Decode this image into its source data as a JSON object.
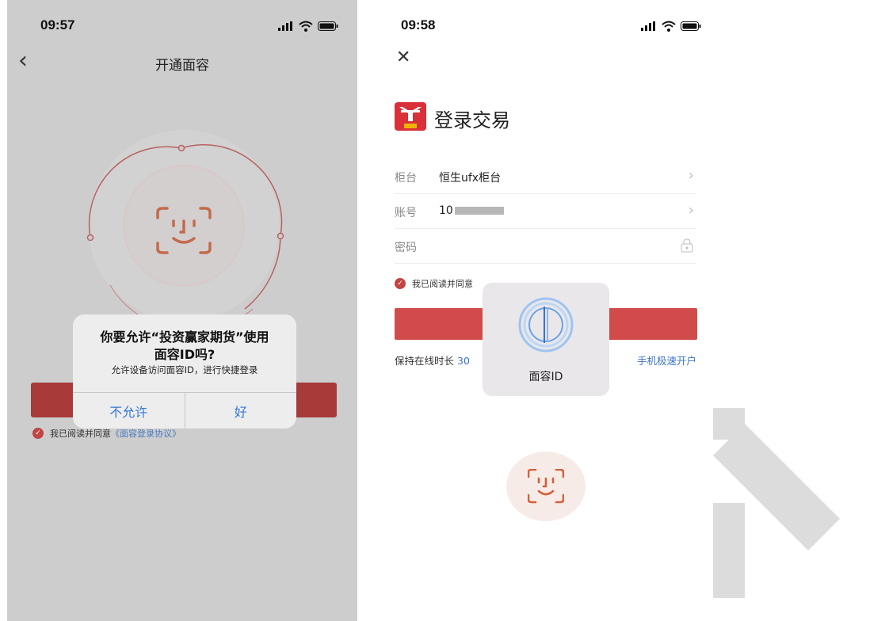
{
  "left_screen": {
    "time": "09:57",
    "nav_title": "开通面容",
    "dialog": {
      "title_line1": "你要允许“投资赢家期货”使用",
      "title_line2": "面容ID吗?",
      "message": "允许设备访问面容ID，进行快捷登录",
      "deny_label": "不允许",
      "allow_label": "好"
    },
    "agree_text": "我已阅读并同意",
    "agree_link": "《面容登录协议》"
  },
  "right_screen": {
    "time": "09:58",
    "title": "登录交易",
    "form": {
      "counter_label": "柜台",
      "counter_value": "恒生ufx柜台",
      "account_label": "账号",
      "account_value": "10",
      "password_label": "密码"
    },
    "agree_text": "我已阅读并同意",
    "keep_online_label": "保持在线时长",
    "keep_online_value": "30",
    "open_account_link": "手机极速开户",
    "faceid_hud_label": "面容ID"
  },
  "colors": {
    "brand_red": "#d24b4b",
    "link_blue": "#3b73c6",
    "dialog_blue": "#3478d6"
  }
}
